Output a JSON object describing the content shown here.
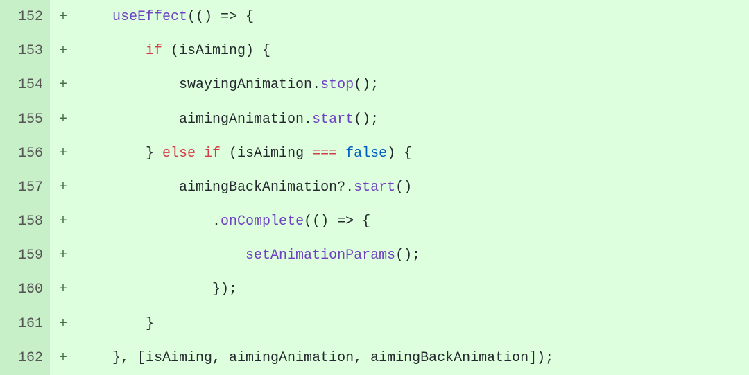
{
  "diff": {
    "rows": [
      {
        "line": "152",
        "marker": "+",
        "indent": "    ",
        "tokens": [
          {
            "t": "useEffect",
            "c": "fn"
          },
          {
            "t": "(() => {",
            "c": "plain"
          }
        ]
      },
      {
        "line": "153",
        "marker": "+",
        "indent": "        ",
        "tokens": [
          {
            "t": "if",
            "c": "kw"
          },
          {
            "t": " (isAiming) {",
            "c": "plain"
          }
        ]
      },
      {
        "line": "154",
        "marker": "+",
        "indent": "            ",
        "tokens": [
          {
            "t": "swayingAnimation.",
            "c": "plain"
          },
          {
            "t": "stop",
            "c": "method"
          },
          {
            "t": "();",
            "c": "plain"
          }
        ]
      },
      {
        "line": "155",
        "marker": "+",
        "indent": "            ",
        "tokens": [
          {
            "t": "aimingAnimation.",
            "c": "plain"
          },
          {
            "t": "start",
            "c": "method"
          },
          {
            "t": "();",
            "c": "plain"
          }
        ]
      },
      {
        "line": "156",
        "marker": "+",
        "indent": "        ",
        "tokens": [
          {
            "t": "} ",
            "c": "plain"
          },
          {
            "t": "else if",
            "c": "kw"
          },
          {
            "t": " (isAiming ",
            "c": "plain"
          },
          {
            "t": "===",
            "c": "kw"
          },
          {
            "t": " ",
            "c": "plain"
          },
          {
            "t": "false",
            "c": "const"
          },
          {
            "t": ") {",
            "c": "plain"
          }
        ]
      },
      {
        "line": "157",
        "marker": "+",
        "indent": "            ",
        "tokens": [
          {
            "t": "aimingBackAnimation?.",
            "c": "plain"
          },
          {
            "t": "start",
            "c": "method"
          },
          {
            "t": "()",
            "c": "plain"
          }
        ]
      },
      {
        "line": "158",
        "marker": "+",
        "indent": "                ",
        "tokens": [
          {
            "t": ".",
            "c": "plain"
          },
          {
            "t": "onComplete",
            "c": "method"
          },
          {
            "t": "(() => {",
            "c": "plain"
          }
        ]
      },
      {
        "line": "159",
        "marker": "+",
        "indent": "                    ",
        "tokens": [
          {
            "t": "setAnimationParams",
            "c": "method"
          },
          {
            "t": "();",
            "c": "plain"
          }
        ]
      },
      {
        "line": "160",
        "marker": "+",
        "indent": "                ",
        "tokens": [
          {
            "t": "});",
            "c": "plain"
          }
        ]
      },
      {
        "line": "161",
        "marker": "+",
        "indent": "        ",
        "tokens": [
          {
            "t": "}",
            "c": "plain"
          }
        ]
      },
      {
        "line": "162",
        "marker": "+",
        "indent": "    ",
        "tokens": [
          {
            "t": "}, [isAiming, aimingAnimation, aimingBackAnimation]);",
            "c": "plain"
          }
        ]
      }
    ]
  }
}
